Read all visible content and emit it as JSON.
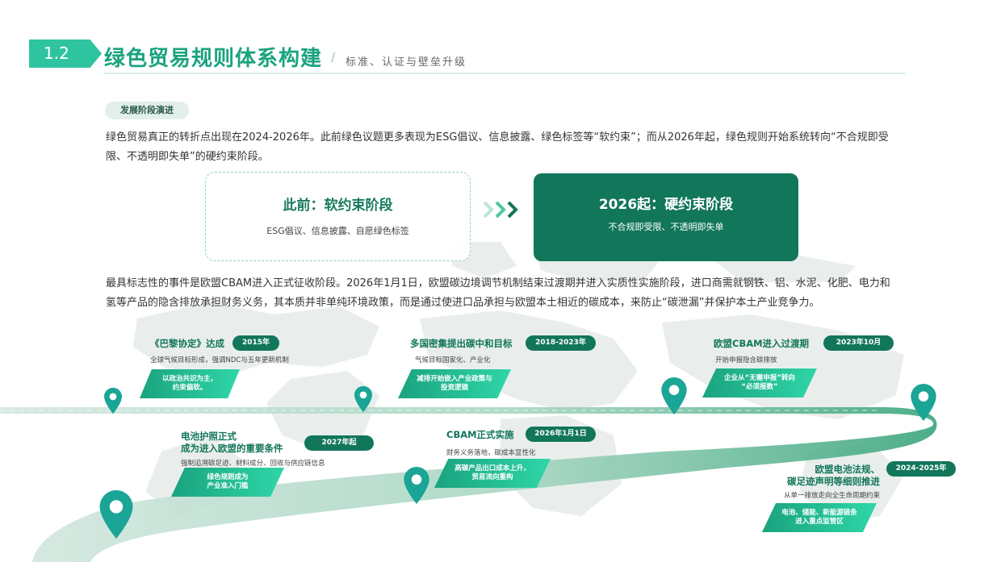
{
  "header": {
    "section_no": "1.2",
    "title": "绿色贸易规则体系构建",
    "slash": "/",
    "subtitle": "标准、认证与壁垒升级"
  },
  "tag": "发展阶段演进",
  "intro": {
    "line1": "绿色贸易真正的转折点出现在2024-2026年。此前绿色议题更多表现为ESG倡议、信息披露、绿色标签等“软约束”；而从2026年起，绿色规则开始系统转向“不合规即受",
    "line2": "限、不透明即失单”的硬约束阶段。"
  },
  "stages": {
    "soft": {
      "title": "此前：软约束阶段",
      "desc": "ESG倡议、信息披露、自愿绿色标签"
    },
    "hard": {
      "title": "2026起：硬约束阶段",
      "desc": "不合规即受限、不透明即失单"
    }
  },
  "detail": {
    "line1": "最具标志性的事件是欧盟CBAM进入正式征收阶段。2026年1月1日，欧盟碳边境调节机制结束过渡期并进入实质性实施阶段，进口商需就钢铁、铝、水泥、化肥、电力和",
    "line2": "氢等产品的隐含排放承担财务义务，其本质并非单纯环境政策，而是通过使进口品承担与欧盟本土相近的碳成本，来防止“碳泄漏”并保护本土产业竞争力。"
  },
  "timeline": {
    "paris": {
      "title": "《巴黎协定》达成",
      "date": "2015年",
      "desc": "全球气候目标形成，强调NDC与五年更新机制",
      "callout": [
        "以政治共识为主，",
        "约束偏软。"
      ]
    },
    "netzero": {
      "title": "多国密集提出碳中和目标",
      "date": "2018-2023年",
      "desc": "气候目标国家化、产业化",
      "callout": [
        "减排开始嵌入产业政策与",
        "投资逻辑"
      ]
    },
    "cbam_transition": {
      "title": "欧盟CBAM进入过渡期",
      "date": "2023年10月",
      "desc": "开始申报隐含碳排放",
      "callout": [
        "企业从“无需申报”转向",
        "“必须报数”"
      ]
    },
    "battery_passport": {
      "title_l1": "电池护照正式",
      "title_l2": "成为进入欧盟的重要条件",
      "date": "2027年起",
      "desc": "强制追溯碳足迹、材料成分、回收与供应链信息",
      "callout": [
        "绿色规则成为",
        "产业准入门槛"
      ]
    },
    "cbam_live": {
      "title": "CBAM正式实施",
      "date": "2026年1月1日",
      "desc": "财务义务落地，碳成本显性化",
      "callout": [
        "高碳产品出口成本上升，",
        "贸易流向重构"
      ]
    },
    "battery_reg": {
      "title_l1": "欧盟电池法规、",
      "title_l2": "碳足迹声明等细则推进",
      "date": "2024-2025年",
      "desc": "从单一排放走向全生命周期约束",
      "callout": [
        "电池、储能、新能源链条",
        "进入重点监管区"
      ]
    }
  },
  "colors": {
    "accent": "#1aa37f",
    "dark": "#12765a",
    "pin": "#1aa596"
  }
}
